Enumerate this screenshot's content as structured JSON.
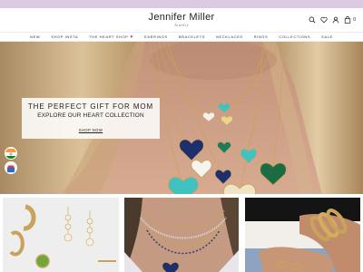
{
  "brand": {
    "name": "Jennifer Miller",
    "tagline": "Jewelry"
  },
  "header": {
    "icons": [
      "search-icon",
      "heart-icon",
      "user-icon",
      "shopping-bag-icon"
    ],
    "bag_count": "0"
  },
  "nav": {
    "items": [
      {
        "label": "NEW"
      },
      {
        "label": "SHOP INSTA"
      },
      {
        "label": "THE HEART SHOP",
        "icon": "heart-icon"
      },
      {
        "label": "EARRINGS"
      },
      {
        "label": "BRACELETS"
      },
      {
        "label": "NECKLACES"
      },
      {
        "label": "RINGS"
      },
      {
        "label": "COLLECTIONS"
      },
      {
        "label": "SALE"
      }
    ]
  },
  "hero": {
    "title": "THE PERFECT GIFT FOR MOM",
    "subtitle": "EXPLORE OUR HEART COLLECTION",
    "cta": "SHOP NOW"
  },
  "side_badges": [
    "country-flag-badge",
    "store-badge"
  ],
  "tiles": [
    {
      "name": "earrings-tile"
    },
    {
      "name": "necklaces-tile"
    },
    {
      "name": "bracelets-tile"
    }
  ],
  "colors": {
    "promo_strip": "#dcc9e3",
    "nav_heart": "#d6304a",
    "turquoise": "#3fc2c0",
    "lapis": "#1f2f6b",
    "malachite": "#1d6b45",
    "gold": "#c9a35a"
  }
}
